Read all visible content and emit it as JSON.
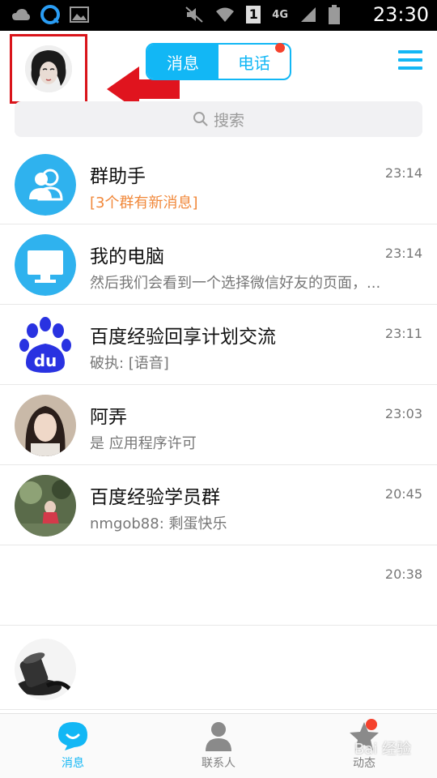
{
  "status_bar": {
    "time": "23:30",
    "network": "4G",
    "sim": "1"
  },
  "header": {
    "tabs": [
      {
        "label": "消息",
        "active": true
      },
      {
        "label": "电话",
        "active": false,
        "badge": true
      }
    ]
  },
  "search": {
    "placeholder": "搜索"
  },
  "conversations": [
    {
      "title": "群助手",
      "subtitle": "[3个群有新消息]",
      "time": "23:14",
      "avatar": "group-assistant-icon"
    },
    {
      "title": "我的电脑",
      "subtitle": "然后我们会看到一个选择微信好友的页面，...",
      "time": "23:14",
      "avatar": "computer-icon"
    },
    {
      "title": "百度经验回享计划交流",
      "subtitle": "破执: [语音]",
      "time": "23:11",
      "avatar": "baidu-paw-icon"
    },
    {
      "title": "阿弄",
      "subtitle": "是 应用程序许可",
      "time": "23:03",
      "avatar": "photo-avatar"
    },
    {
      "title": "百度经验学员群",
      "subtitle": "nmgob88: 剩蛋快乐",
      "time": "20:45",
      "avatar": "photo-avatar"
    },
    {
      "title": "",
      "subtitle": "",
      "time": "20:38",
      "avatar": ""
    },
    {
      "title": "",
      "subtitle": "",
      "time": "",
      "avatar": "photo-avatar"
    }
  ],
  "bottom_nav": [
    {
      "label": "消息",
      "active": true
    },
    {
      "label": "联系人",
      "active": false
    },
    {
      "label": "动态",
      "active": false,
      "badge": true
    }
  ],
  "watermark": "Bai 经验",
  "colors": {
    "accent": "#12b7f5",
    "badge": "#f5412c",
    "highlight": "#d9141a",
    "orange": "#f1883a"
  }
}
